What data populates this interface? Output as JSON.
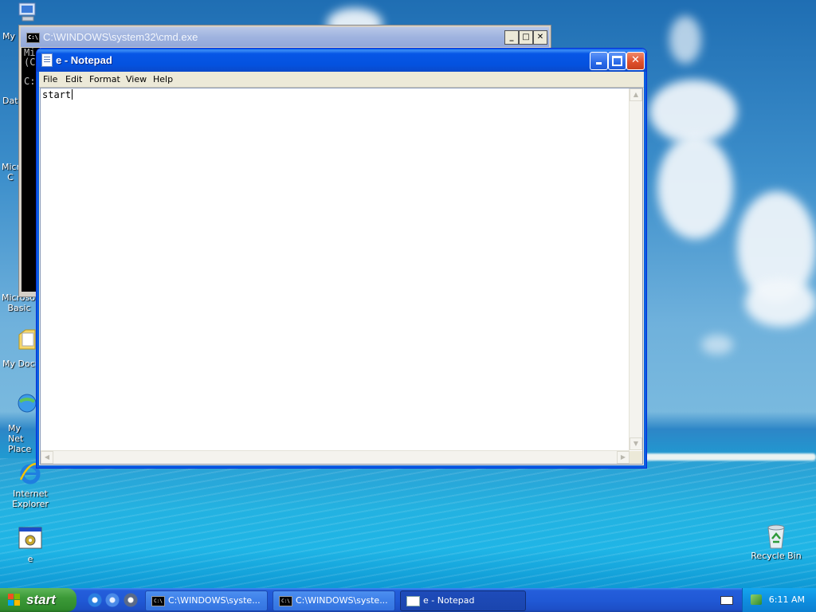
{
  "desktop": {
    "icons": [
      {
        "label": "My",
        "name": "my-computer-icon"
      },
      {
        "label": "Dat",
        "name": "data-icon"
      },
      {
        "label": "Micro C",
        "name": "microsoft-c-icon"
      },
      {
        "label": "Microsof Basic",
        "name": "microsoft-basic-icon"
      },
      {
        "label": "My Docu",
        "name": "my-documents-icon"
      },
      {
        "label": "My Net Place",
        "name": "my-network-places-icon"
      },
      {
        "label": "Internet Explorer",
        "name": "internet-explorer-icon"
      },
      {
        "label": "e",
        "name": "e-shortcut-icon"
      },
      {
        "label": "Recycle Bin",
        "name": "recycle-bin-icon"
      }
    ]
  },
  "cmd_window": {
    "title": "C:\\WINDOWS\\system32\\cmd.exe",
    "console_lines": [
      "Mi",
      "(C",
      "",
      "C:"
    ]
  },
  "notepad": {
    "title": "e - Notepad",
    "menu": [
      "File",
      "Edit",
      "Format",
      "View",
      "Help"
    ],
    "content": "start"
  },
  "taskbar": {
    "start_label": "start",
    "tasks": [
      {
        "label": "C:\\WINDOWS\\syste...",
        "active": false
      },
      {
        "label": "C:\\WINDOWS\\syste...",
        "active": false
      },
      {
        "label": "e - Notepad",
        "active": true
      }
    ],
    "clock": "6:11 AM"
  },
  "colors": {
    "titlebar_active": "#0452df",
    "taskbar": "#2059d6",
    "start_button": "#3c9a38",
    "tray": "#0f8fe0"
  }
}
